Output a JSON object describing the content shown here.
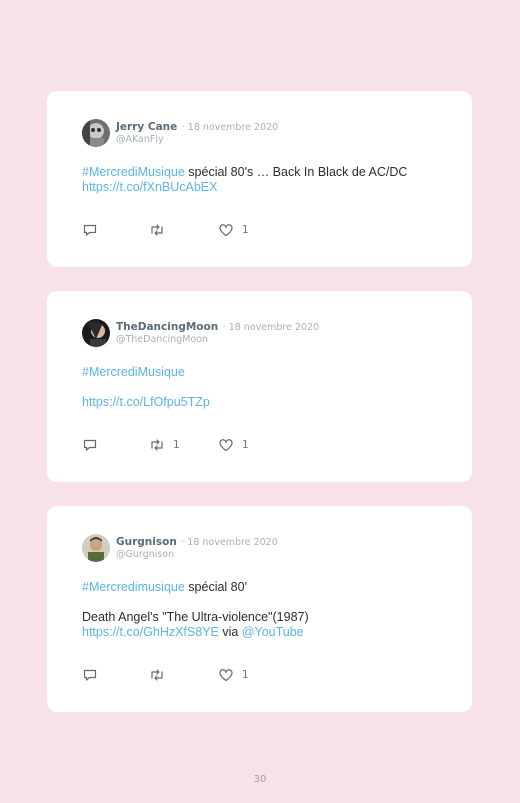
{
  "tweets": [
    {
      "name": "Jerry Cane",
      "date": "· 18 novembre 2020",
      "handle": "@AKanFly",
      "tag": "#MercrediMusique",
      "text": " spécial 80's … Back In Black de AC/DC",
      "link": "https://t.co/fXnBUcAbEX",
      "retweets": "",
      "likes": "1"
    },
    {
      "name": "TheDancingMoon",
      "date": "· 18 novembre 2020",
      "handle": "@TheDancingMoon",
      "tag": "#MercrediMusique",
      "link": "https://t.co/LfOfpu5TZp",
      "retweets": "1",
      "likes": "1"
    },
    {
      "name": "Gurgnison",
      "date": "· 18 novembre 2020",
      "handle": "@Gurgnison",
      "tag": "#Mercredimusique",
      "text": " spécial 80'",
      "text2": "Death Angel's \"The Ultra-violence\"(1987)",
      "link": "https://t.co/GhHzXfS8YE",
      "via": " via ",
      "mention": "@YouTube",
      "retweets": "",
      "likes": "1"
    }
  ],
  "page_number": "30"
}
